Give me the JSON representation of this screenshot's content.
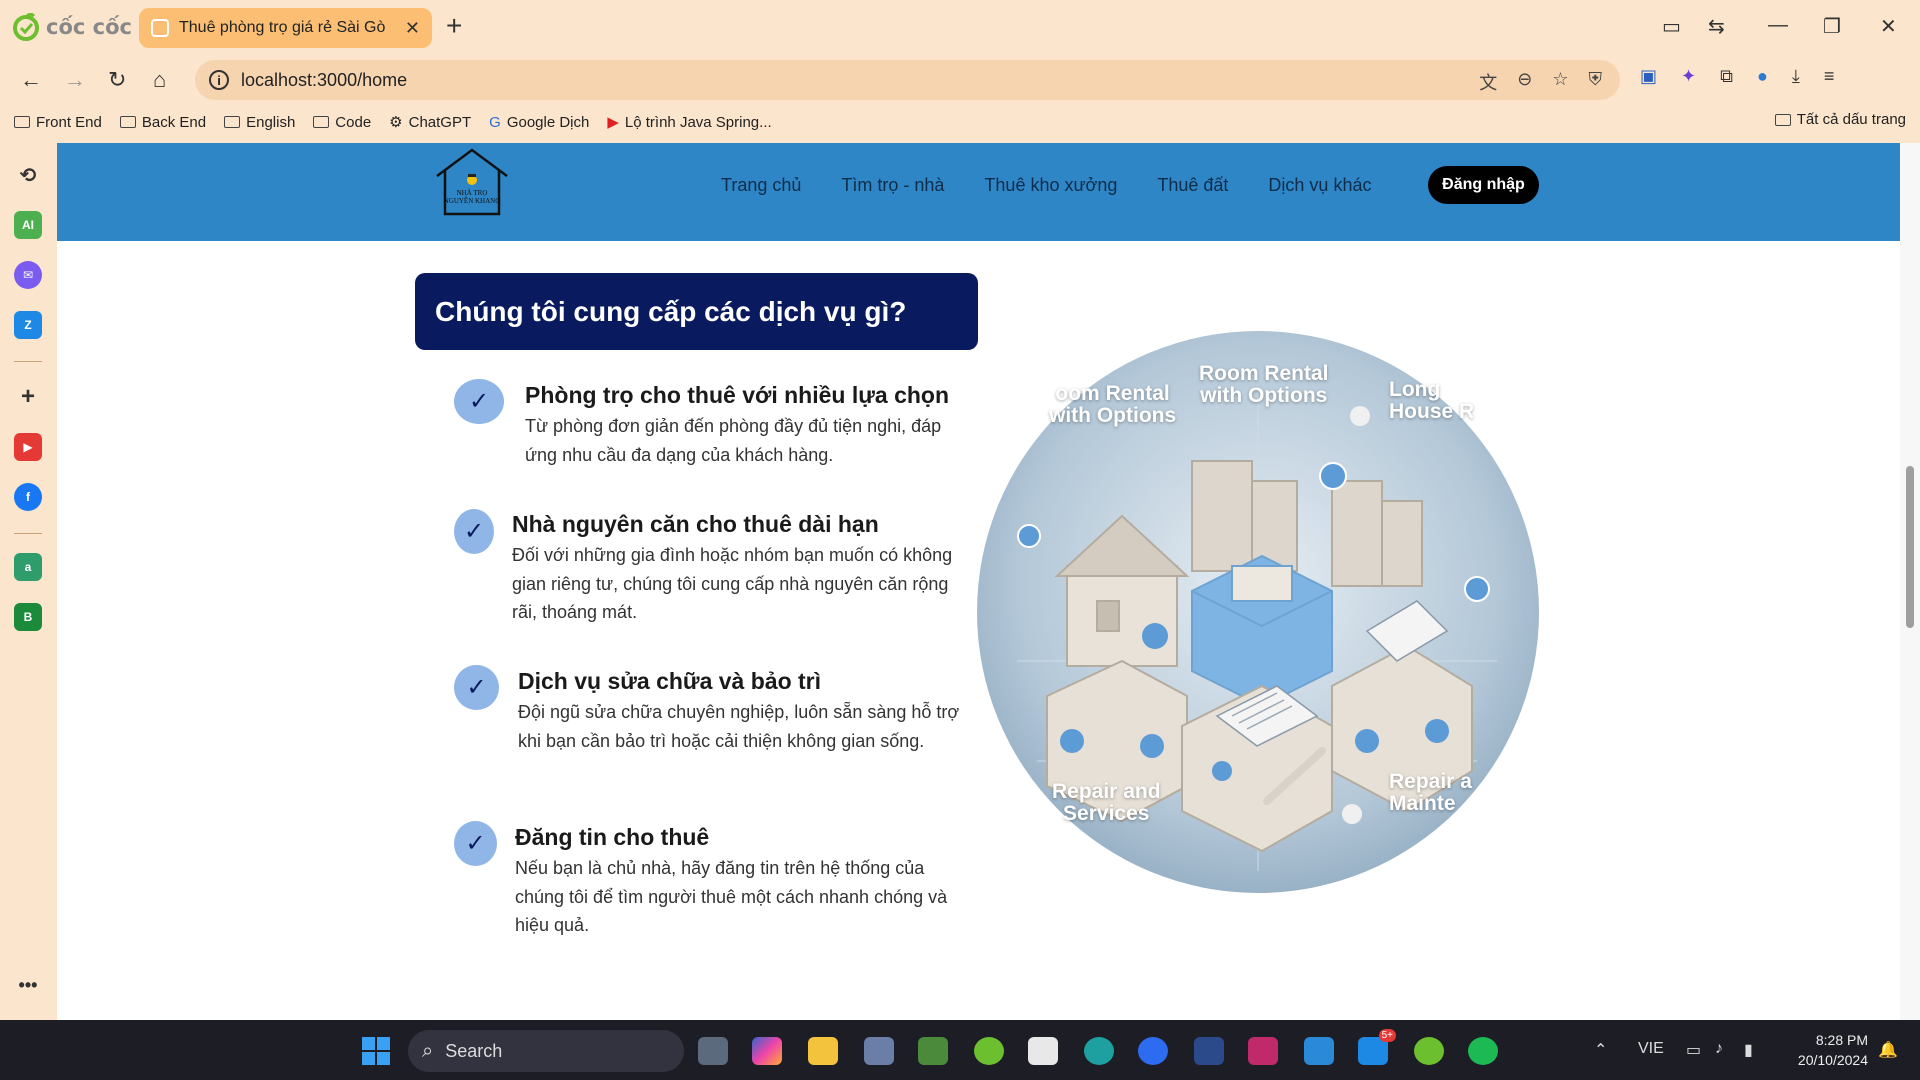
{
  "browser": {
    "brand": "cốc cốc",
    "tab_title": "Thuê phòng trọ giá rẻ Sài Gò",
    "url": "localhost:3000/home",
    "bookmarks": [
      "Front End",
      "Back End",
      "English",
      "Code",
      "ChatGPT",
      "Google Dịch",
      "Lộ trình Java Spring..."
    ],
    "all_bookmarks": "Tất cả dấu trang"
  },
  "site": {
    "logo_text_line1": "NHÀ TRỌ",
    "logo_text_line2": "NGUYỄN KHANG",
    "menu": [
      "Trang chủ",
      "Tìm trọ - nhà",
      "Thuê kho xưởng",
      "Thuê đất",
      "Dịch vụ khác"
    ],
    "login": "Đăng nhập"
  },
  "services_section": {
    "title": "Chúng tôi cung cấp các dịch vụ gì?",
    "items": [
      {
        "title": "Phòng trọ cho thuê với nhiều lựa chọn",
        "desc": "Từ phòng đơn giản đến phòng đầy đủ tiện nghi, đáp ứng nhu cầu đa dạng của khách hàng."
      },
      {
        "title": "Nhà nguyên căn cho thuê dài hạn",
        "desc": "Đối với những gia đình hoặc nhóm bạn muốn có không gian riêng tư, chúng tôi cung cấp nhà nguyên căn rộng rãi, thoáng mát."
      },
      {
        "title": "Dịch vụ sửa chữa và bảo trì",
        "desc": "Đội ngũ sửa chữa chuyên nghiệp, luôn sẵn sàng hỗ trợ khi bạn cần bảo trì hoặc cải thiện không gian sống."
      },
      {
        "title": "Đăng tin cho thuê",
        "desc": "Nếu bạn là chủ nhà, hãy đăng tin trên hệ thống của chúng tôi để tìm người thuê một cách nhanh chóng và hiệu quả."
      }
    ],
    "illustration_labels": [
      "oom Rental\nwith Options",
      "Room Rental\nwith Options",
      "Long\nHouse R",
      "Repair and\nServices",
      "Repair a\nMainte"
    ]
  },
  "taskbar": {
    "search": "Search",
    "lang": "VIE",
    "time": "8:28 PM",
    "date": "20/10/2024",
    "zalo_badge": "5+"
  },
  "colors": {
    "chrome_bg": "#fce5cd",
    "active_tab": "#fbbe72",
    "header_blue": "#2e86c6",
    "title_navy": "#0a1a5e",
    "check_blue": "#8fb6e6"
  }
}
